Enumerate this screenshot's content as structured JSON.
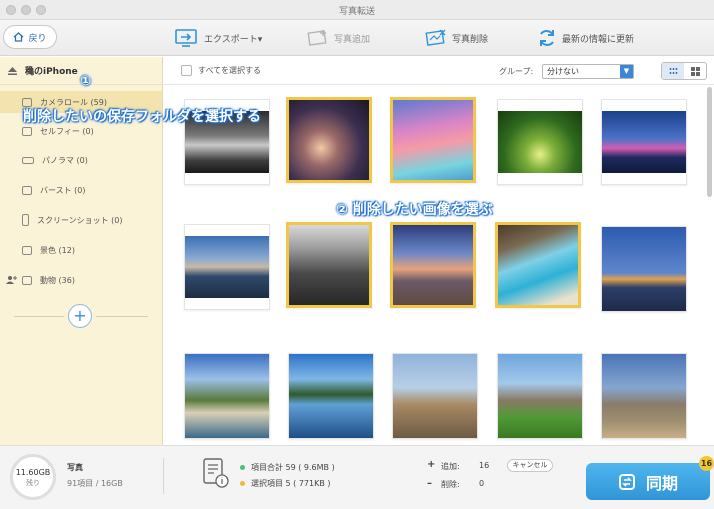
{
  "window": {
    "title": "写真転送"
  },
  "toolbar": {
    "back_label": "戻り",
    "export_label": "エクスポート▾",
    "add_label": "写真追加",
    "delete_label": "写真削除",
    "refresh_label": "最新の情報に更新"
  },
  "sidebar": {
    "device": "穐のiPhone",
    "items": [
      {
        "label": "カメラロール (59)",
        "icon": "camera-icon"
      },
      {
        "label": "セルフィー (0)",
        "icon": "selfie-icon"
      },
      {
        "label": "パノラマ (0)",
        "icon": "panorama-icon"
      },
      {
        "label": "バースト (0)",
        "icon": "burst-icon"
      },
      {
        "label": "スクリーンショット (0)",
        "icon": "screenshot-icon"
      },
      {
        "label": "景色 (12)",
        "icon": "landscape-icon"
      },
      {
        "label": "動物 (36)",
        "icon": "animal-icon"
      }
    ]
  },
  "main": {
    "select_all": "すべてを選択する",
    "group_label": "グループ:",
    "group_value": "分けない"
  },
  "annotations": {
    "step1_num": "①",
    "step1": "削除したいの保存フォルダを選択する",
    "step2": "② 削除したい画像を選ぶ"
  },
  "photos": [
    {
      "name": "black-white-room",
      "selected": false
    },
    {
      "name": "rocks-sunset",
      "selected": true
    },
    {
      "name": "pink-clouds-sky",
      "selected": true
    },
    {
      "name": "tree-tunnel-road",
      "selected": false
    },
    {
      "name": "ferris-wheel-night",
      "selected": false
    },
    {
      "name": "lake-dusk",
      "selected": false
    },
    {
      "name": "city-street-bw",
      "selected": true
    },
    {
      "name": "driftwood-sunset",
      "selected": true
    },
    {
      "name": "sea-cave-beach",
      "selected": true
    },
    {
      "name": "castle-by-lake",
      "selected": false
    },
    {
      "name": "alpine-village",
      "selected": false
    },
    {
      "name": "mountain-lake",
      "selected": false
    },
    {
      "name": "jumping-people",
      "selected": false
    },
    {
      "name": "elephants-grass",
      "selected": false
    },
    {
      "name": "elephants-herd",
      "selected": false
    }
  ],
  "status": {
    "capacity": "11.60GB",
    "capacity_sub": "残り",
    "media_type": "写真",
    "media_count": "91項目 / 16GB",
    "total_items": "項目合計 59 ( 9.6MB )",
    "selected_items": "選択項目 5 ( 771KB )",
    "add_label": "追加:",
    "add_value": "16",
    "delete_label": "削除:",
    "delete_value": "0",
    "cancel_label": "キャンセル",
    "sync_label": "同期",
    "sync_badge": "16"
  },
  "colors": {
    "accent": "#2f95d8",
    "selection": "#f1c74a",
    "sidebar_bg": "#fbf3d8",
    "sidebar_active": "#f3e3ae"
  }
}
